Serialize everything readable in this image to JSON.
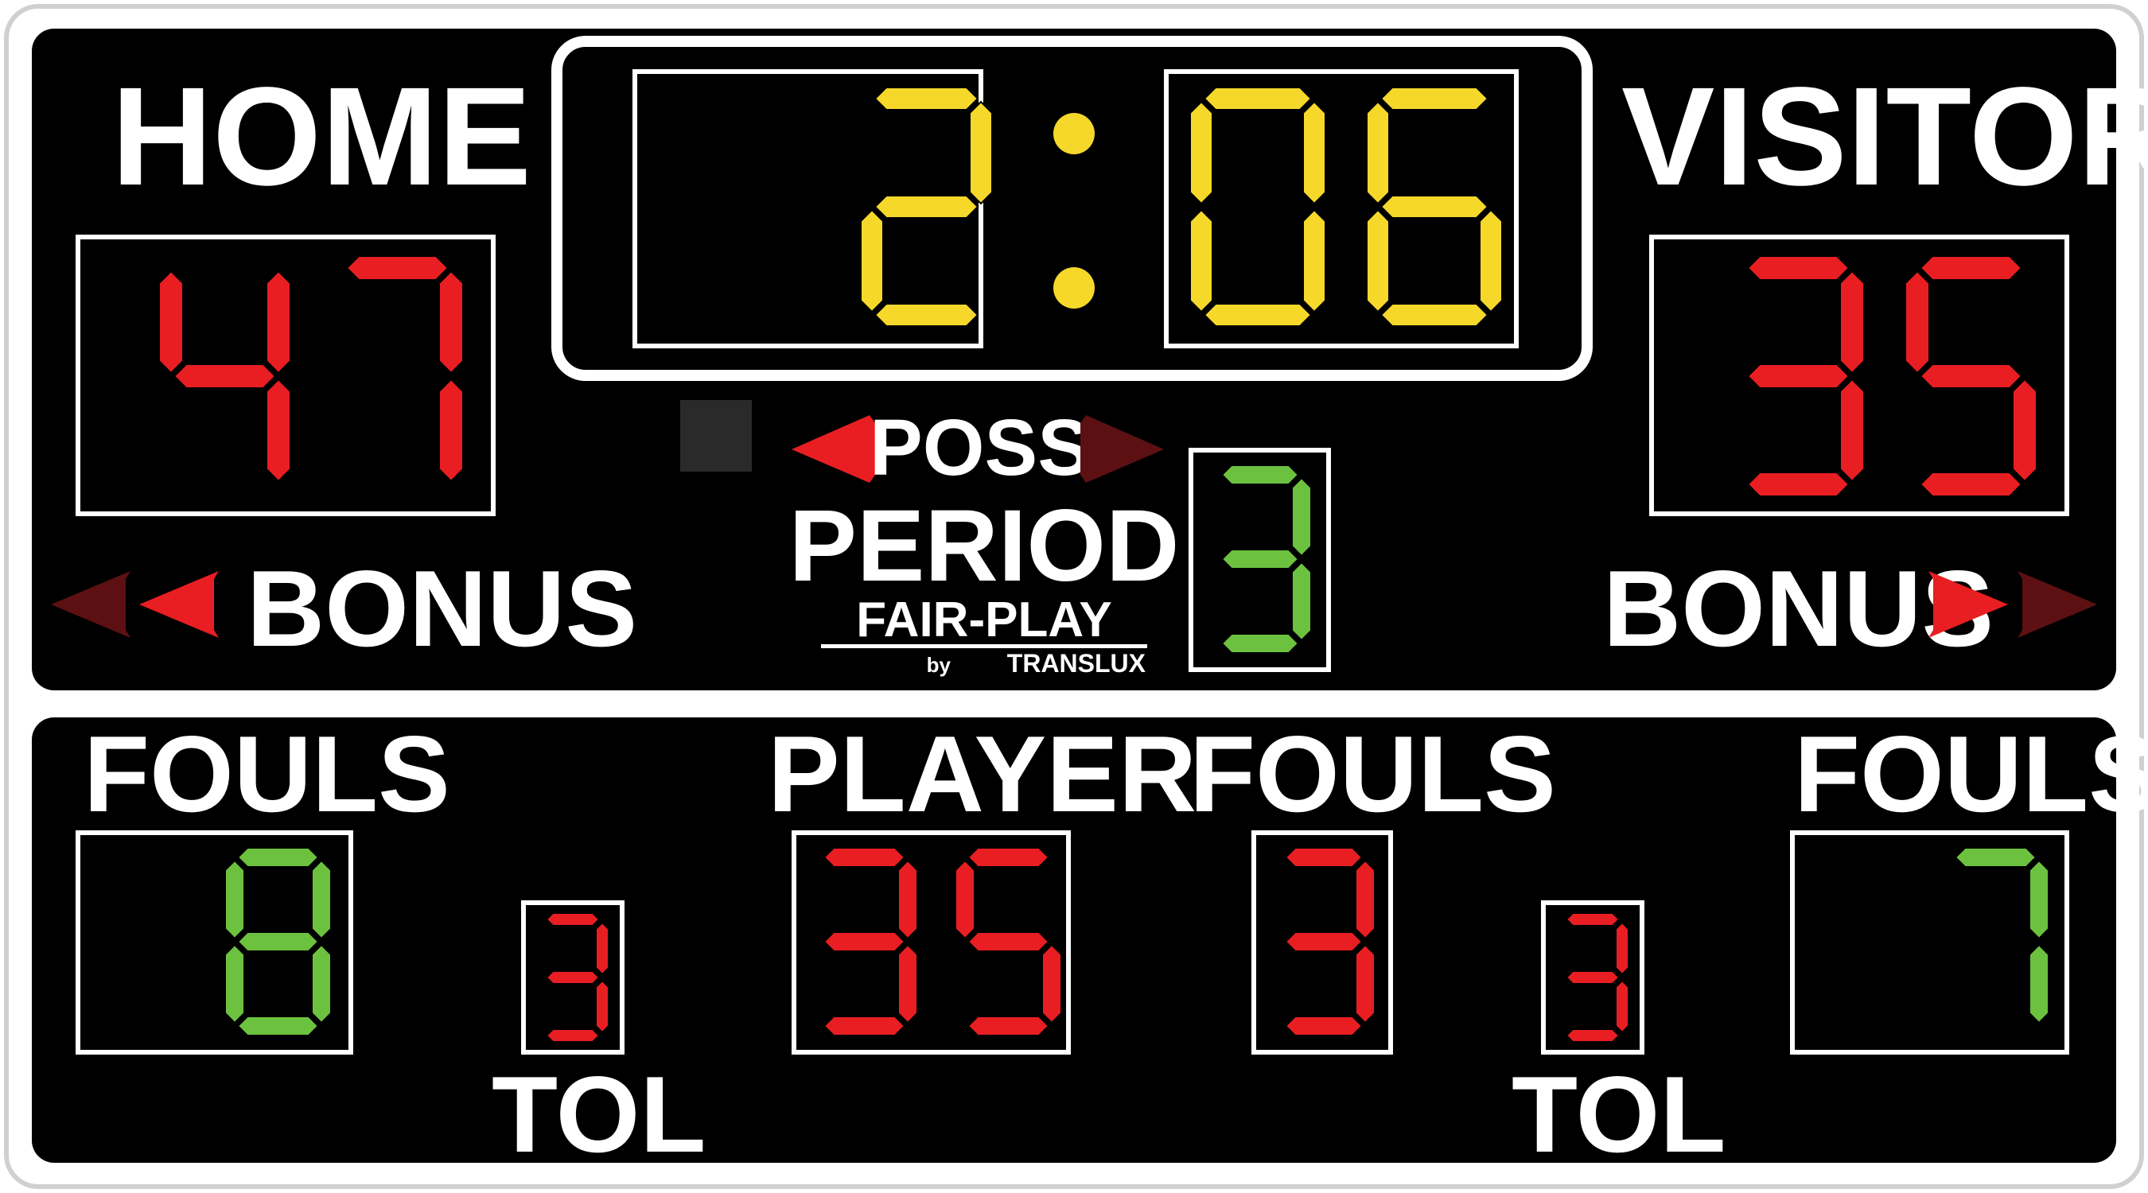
{
  "colors": {
    "red_on": "#e81e22",
    "red_dim": "#5c1012",
    "yellow_on": "#f5d82a",
    "green_on": "#6cc23f",
    "frame": "#ffffff",
    "panel": "#000000"
  },
  "home": {
    "label": "HOME",
    "score": "47",
    "bonus_label": "BONUS",
    "fouls_label": "FOULS",
    "fouls": "8",
    "tol_label": "TOL",
    "tol": "3"
  },
  "visitor": {
    "label": "VISITOR",
    "score": "35",
    "bonus_label": "BONUS",
    "fouls_label": "FOULS",
    "fouls": "7",
    "tol_label": "TOL",
    "tol": "3"
  },
  "clock": {
    "minutes": "2",
    "seconds": "06",
    "separator": ":"
  },
  "possession": {
    "label": "POSS",
    "home_arrow_lit": true,
    "visitor_arrow_lit": false
  },
  "period": {
    "label": "PERIOD",
    "value": "3"
  },
  "brand": {
    "name": "FAIR-PLAY",
    "by": "by",
    "company": "TRANSLUX"
  },
  "player": {
    "label": "PLAYER",
    "number": "35",
    "fouls_label": "FOULS",
    "fouls": "3"
  },
  "bonus_indicators": {
    "home_arrows": [
      false,
      true
    ],
    "visitor_arrows": [
      true,
      false
    ]
  }
}
